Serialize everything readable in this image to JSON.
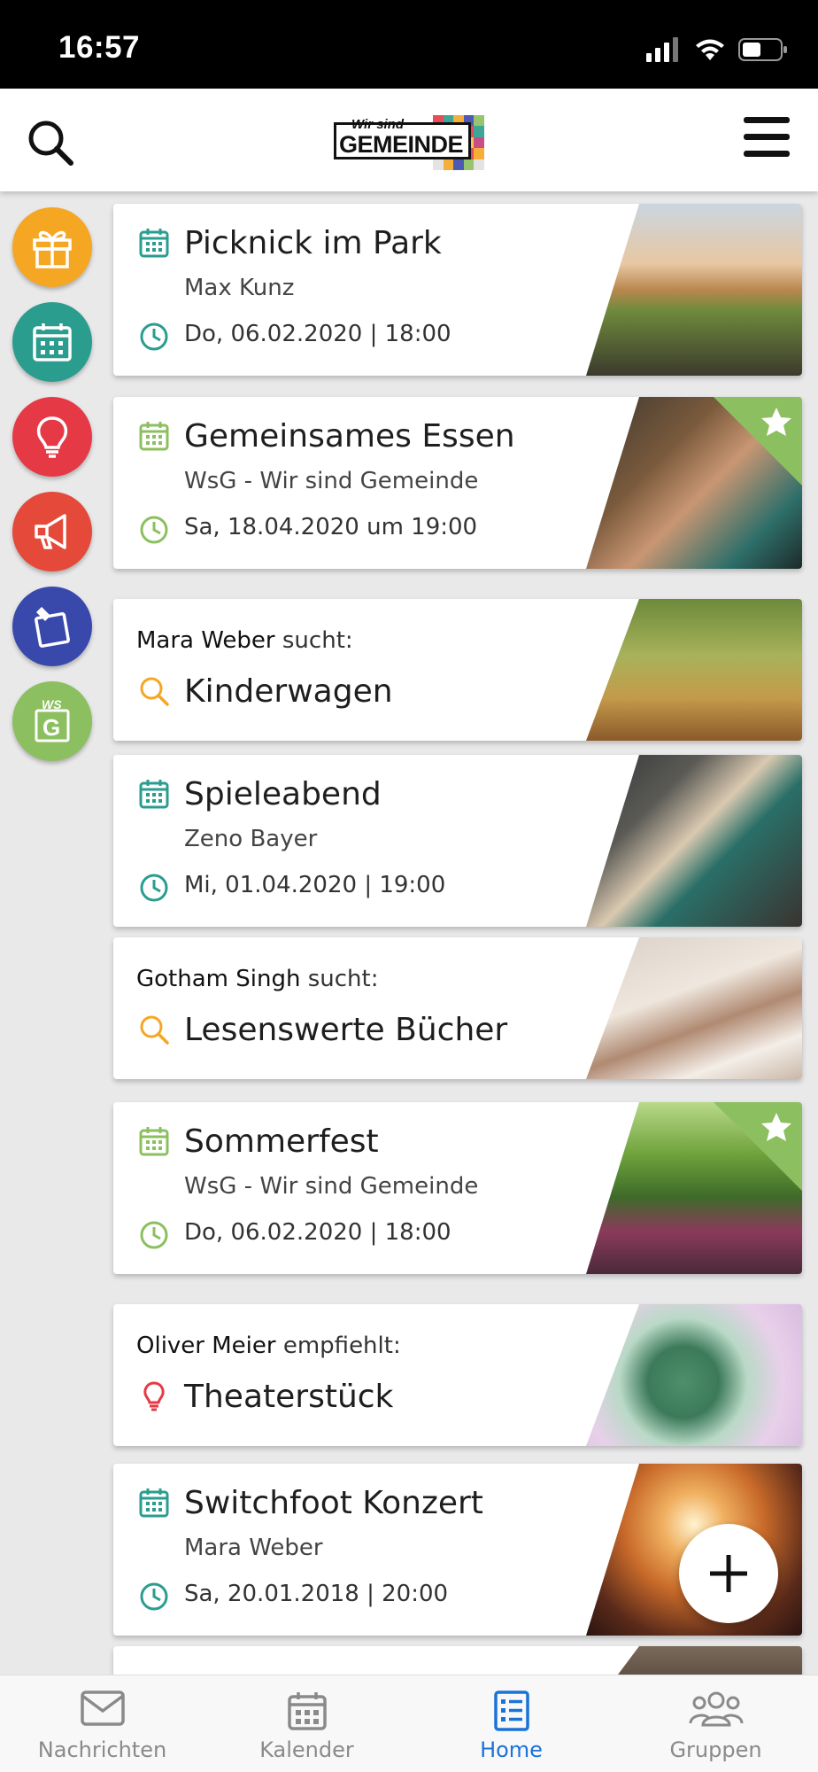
{
  "status_bar": {
    "time": "16:57"
  },
  "header": {
    "logo_top": "Wir sind",
    "logo_main": "GEMEINDE"
  },
  "side_menu": [
    {
      "icon": "gift-icon",
      "color": "#f5a623"
    },
    {
      "icon": "calendar-icon",
      "color": "#2a9d8f"
    },
    {
      "icon": "lightbulb-icon",
      "color": "#e63946"
    },
    {
      "icon": "megaphone-icon",
      "color": "#e4493a"
    },
    {
      "icon": "pin-board-icon",
      "color": "#3949ab"
    },
    {
      "icon": "wsg-group-icon",
      "color": "#8cbf5f"
    }
  ],
  "cards": [
    {
      "type": "event",
      "title": "Picknick im Park",
      "organizer": "Max Kunz",
      "date": "Do, 06.02.2020 | 18:00",
      "accent": "#2a9d8f",
      "featured": false
    },
    {
      "type": "event",
      "title": "Gemeinsames Essen",
      "organizer": "WsG - Wir sind Gemeinde",
      "date": "Sa, 18.04.2020 um 19:00",
      "accent": "#8cbf5f",
      "featured": true
    },
    {
      "type": "search",
      "person": "Mara Weber",
      "verb": "sucht:",
      "title": "Kinderwagen",
      "accent": "#f5a623"
    },
    {
      "type": "event",
      "title": "Spieleabend",
      "organizer": "Zeno Bayer",
      "date": "Mi, 01.04.2020 | 19:00",
      "accent": "#2a9d8f",
      "featured": false
    },
    {
      "type": "search",
      "person": "Gotham Singh",
      "verb": "sucht:",
      "title": "Lesenswerte Bücher",
      "accent": "#f5a623"
    },
    {
      "type": "event",
      "title": "Sommerfest",
      "organizer": "WsG - Wir sind Gemeinde",
      "date": "Do, 06.02.2020 | 18:00",
      "accent": "#8cbf5f",
      "featured": true
    },
    {
      "type": "recommend",
      "person": "Oliver Meier",
      "verb": "empfiehlt:",
      "title": "Theaterstück",
      "accent": "#e63946"
    },
    {
      "type": "event",
      "title": "Switchfoot Konzert",
      "organizer": "Mara Weber",
      "date": "Sa, 20.01.2018 | 20:00",
      "accent": "#2a9d8f",
      "featured": false
    }
  ],
  "tabs": [
    {
      "label": "Nachrichten",
      "icon": "envelope-icon"
    },
    {
      "label": "Kalender",
      "icon": "calendar-icon"
    },
    {
      "label": "Home",
      "icon": "home-list-icon",
      "active": true
    },
    {
      "label": "Gruppen",
      "icon": "group-icon"
    }
  ],
  "colors": {
    "active_tab": "#1a73d8",
    "teal": "#2a9d8f",
    "green": "#8cbf5f",
    "orange": "#f5a623",
    "red": "#e63946"
  }
}
